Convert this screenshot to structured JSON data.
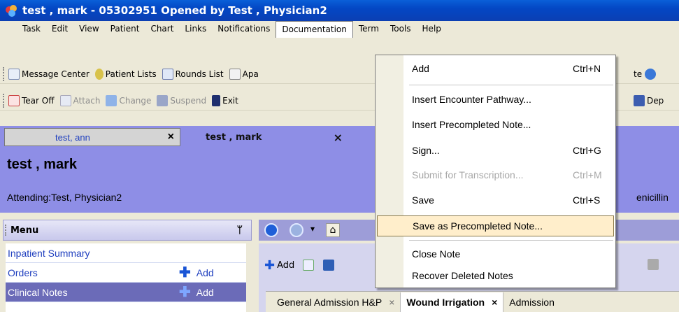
{
  "window": {
    "title": "test , mark  - 05302951 Opened by Test , Physician2"
  },
  "menubar": {
    "items": [
      "Task",
      "Edit",
      "View",
      "Patient",
      "Chart",
      "Links",
      "Notifications",
      "Documentation",
      "Term",
      "Tools",
      "Help"
    ]
  },
  "toolbar1": {
    "message_center": "Message Center",
    "patient_lists": "Patient Lists",
    "rounds_list": "Rounds List",
    "apache": "Apa",
    "trailing": "te"
  },
  "toolbar2": {
    "tear_off": "Tear Off",
    "attach": "Attach",
    "change": "Change",
    "suspend": "Suspend",
    "exit": "Exit",
    "dep": "Dep"
  },
  "patient_tabs": [
    {
      "name": "test, ann",
      "close": "×"
    },
    {
      "name": "test , mark",
      "close": "×"
    }
  ],
  "banner": {
    "patient_name": "test , mark",
    "attending": "Attending:Test, Physician2",
    "allergy": "enicillin"
  },
  "left_pane": {
    "header": "Menu",
    "pin": "ᛘ",
    "items": [
      {
        "label": "Inpatient Summary",
        "add": ""
      },
      {
        "label": "Orders",
        "add": "Add"
      },
      {
        "label": "Clinical Notes",
        "add": "Add"
      }
    ]
  },
  "right_pane": {
    "add_label": "Add",
    "doc_tabs": [
      {
        "label": "General Admission H&P",
        "close": "×"
      },
      {
        "label": "Wound Irrigation",
        "close": "×"
      },
      {
        "label": "Admission",
        "close": ""
      }
    ]
  },
  "documentation_menu": {
    "items": [
      {
        "label": "Add",
        "shortcut": "Ctrl+N"
      },
      {
        "label": "Insert Encounter Pathway...",
        "shortcut": ""
      },
      {
        "label": "Insert Precompleted Note...",
        "shortcut": ""
      },
      {
        "label": "Sign...",
        "shortcut": "Ctrl+G"
      },
      {
        "label": "Submit for Transcription...",
        "shortcut": "Ctrl+M"
      },
      {
        "label": "Save",
        "shortcut": "Ctrl+S"
      },
      {
        "label": "Save as Precompleted Note...",
        "shortcut": ""
      },
      {
        "label": "Close Note",
        "shortcut": ""
      },
      {
        "label": "Recover Deleted Notes",
        "shortcut": ""
      }
    ]
  },
  "colors": {
    "title_bar": "#0347c4",
    "banner": "#8e8ee6",
    "menu_hover": "#ffeecb",
    "link": "#1f3fbf"
  }
}
